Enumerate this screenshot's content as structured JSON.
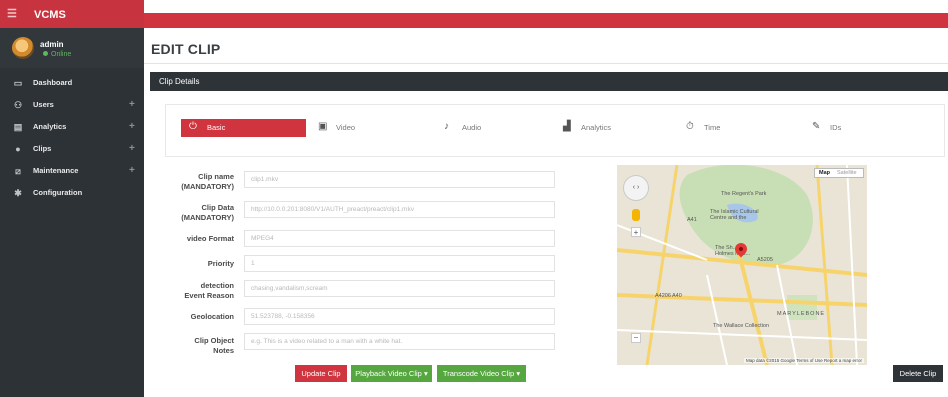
{
  "app": {
    "name": "VCMS",
    "menu_icon": "hamburger-icon"
  },
  "user": {
    "name": "admin",
    "status": "Online"
  },
  "sidebar": {
    "items": [
      {
        "label": "Dashboard",
        "icon": "dashboard-icon",
        "expandable": false
      },
      {
        "label": "Users",
        "icon": "users-icon",
        "expandable": true
      },
      {
        "label": "Analytics",
        "icon": "analytics-icon",
        "expandable": true
      },
      {
        "label": "Clips",
        "icon": "clips-icon",
        "expandable": true
      },
      {
        "label": "Maintenance",
        "icon": "maintenance-icon",
        "expandable": true
      },
      {
        "label": "Configuration",
        "icon": "gear-icon",
        "expandable": false
      }
    ]
  },
  "page": {
    "title": "EDIT CLIP",
    "section": "Clip Details"
  },
  "tabs": [
    {
      "label": "Basic",
      "icon": "power-icon",
      "active": true
    },
    {
      "label": "Video",
      "icon": "film-icon",
      "active": false
    },
    {
      "label": "Audio",
      "icon": "microphone-icon",
      "active": false
    },
    {
      "label": "Analytics",
      "icon": "bar-chart-icon",
      "active": false
    },
    {
      "label": "Time",
      "icon": "stopwatch-icon",
      "active": false
    },
    {
      "label": "IDs",
      "icon": "pencil-icon",
      "active": false
    }
  ],
  "form": {
    "clip_name_label": "Clip name",
    "clip_name_sub": "(MANDATORY)",
    "clip_name_value": "clip1.mkv",
    "clip_data_label": "Clip Data",
    "clip_data_sub": "(MANDATORY)",
    "clip_data_value": "http://10.0.0.201:8080/V1/AUTH_preact/preact/clip1.mkv",
    "video_format_label": "video Format",
    "video_format_value": "MPEG4",
    "priority_label": "Priority",
    "priority_value": "1",
    "detection_label": "detection",
    "detection_sub": "Event Reason",
    "detection_value": "chasing,vandalism,scream",
    "geolocation_label": "Geolocation",
    "geolocation_value": "51.523788, -0.158356",
    "notes_label": "Clip Object",
    "notes_sub": "Notes",
    "notes_placeholder": "e.g. This is a video related to a man with a white hat."
  },
  "buttons": {
    "update": "Update Clip",
    "playback": "Playback Video Clip",
    "transcode": "Transcode Video Clip",
    "delete": "Delete Clip",
    "caret": "▾"
  },
  "map": {
    "map_label": "Map",
    "satellite_label": "Satellite",
    "attribution": "Map data ©2015 Google   Terms of Use   Report a map error",
    "places": {
      "regents_park": "The Regent's Park",
      "islamic_centre": "The Islamic Cultural Centre and the",
      "madame": "The Sh... Holmes Mus...",
      "marylebone": "MARYLEBONE",
      "wallace": "The Wallace Collection",
      "road_a1": "A41",
      "road_a2": "A5205",
      "road_a3": "A4206",
      "road_a4": "A40"
    },
    "colors": {
      "park": "#c8dfb5",
      "water": "#a8c7e8",
      "road_major": "#f7d46b",
      "road_minor": "#ffffff"
    }
  },
  "colors": {
    "brand": "#d0343e",
    "sidebar": "#2d3236",
    "success": "#56a740",
    "dark": "#2e3338"
  }
}
